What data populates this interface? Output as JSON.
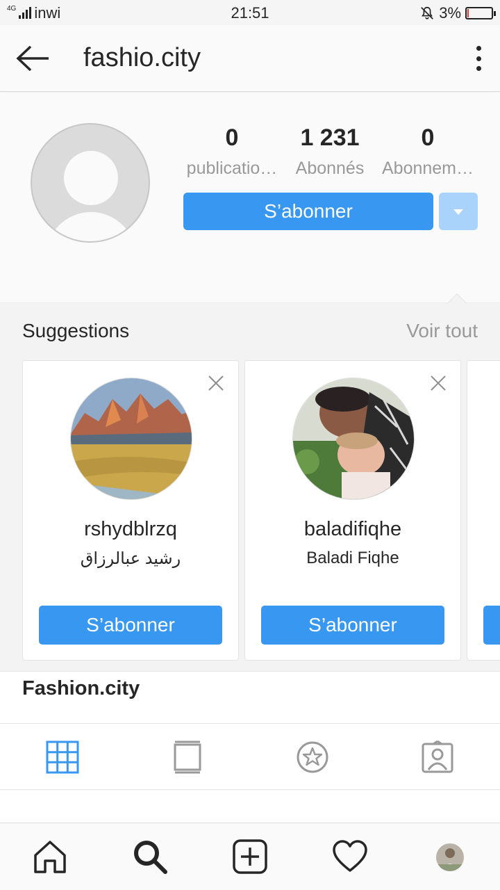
{
  "status_bar": {
    "network_type": "4G",
    "carrier": "inwi",
    "time": "21:51",
    "battery_percent": "3%",
    "battery_level": 0.03,
    "battery_color": "#e53935"
  },
  "header": {
    "title": "fashio.city",
    "back_icon": "arrow-left-icon",
    "more_icon": "more-vertical-icon"
  },
  "profile": {
    "stats": [
      {
        "value": "0",
        "label": "publicatio…"
      },
      {
        "value": "1 231",
        "label": "Abonnés"
      },
      {
        "value": "0",
        "label": "Abonnem…"
      }
    ],
    "follow_label": "S’abonner",
    "accent_color": "#3897f0"
  },
  "suggestions": {
    "title": "Suggestions",
    "see_all": "Voir tout",
    "cards": [
      {
        "username": "rshydblrzq",
        "full_name": "رشيد عبالرزاق",
        "button": "S’abonner"
      },
      {
        "username": "baladifiqhe",
        "full_name": "Baladi Fiqhe",
        "button": "S’abonner"
      }
    ]
  },
  "bio": {
    "name": "Fashion.city"
  },
  "view_tabs": [
    {
      "icon": "grid-icon",
      "active": true
    },
    {
      "icon": "feed-list-icon",
      "active": false
    },
    {
      "icon": "star-badge-icon",
      "active": false
    },
    {
      "icon": "tagged-person-icon",
      "active": false
    }
  ],
  "bottom_nav": [
    {
      "icon": "home-icon"
    },
    {
      "icon": "search-icon"
    },
    {
      "icon": "add-post-icon"
    },
    {
      "icon": "heart-icon"
    },
    {
      "icon": "profile-avatar-icon"
    }
  ]
}
